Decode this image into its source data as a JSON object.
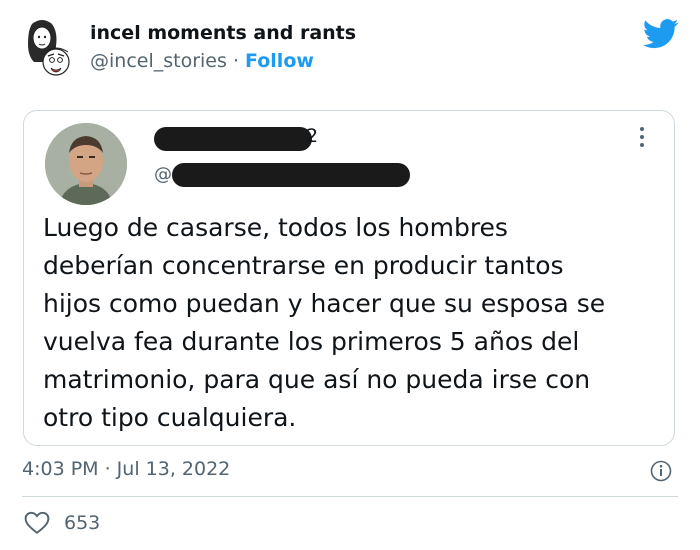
{
  "author": {
    "display_name": "incel moments and rants",
    "handle": "@incel_stories",
    "separator": "·",
    "follow_label": "Follow"
  },
  "quoted": {
    "name_suffix": "2",
    "at_sign": "@",
    "text": "Luego de casarse, todos los hombres\ndeberían concentrarse en producir tantos\nhijos como puedan y hacer que su esposa se\nvuelva fea durante los primeros 5 años del\nmatrimonio, para que así no pueda irse con\notro tipo cualquiera."
  },
  "meta": {
    "timestamp": "4:03 PM · Jul 13, 2022"
  },
  "engagement": {
    "likes": "653"
  },
  "colors": {
    "accent": "#1d9bf0",
    "text_primary": "#0f1419",
    "text_secondary": "#536471",
    "border": "#cfd9de"
  },
  "icons": [
    "cartoon-avatar-icon",
    "twitter-bird-icon",
    "more-options-icon",
    "info-icon",
    "heart-icon"
  ]
}
